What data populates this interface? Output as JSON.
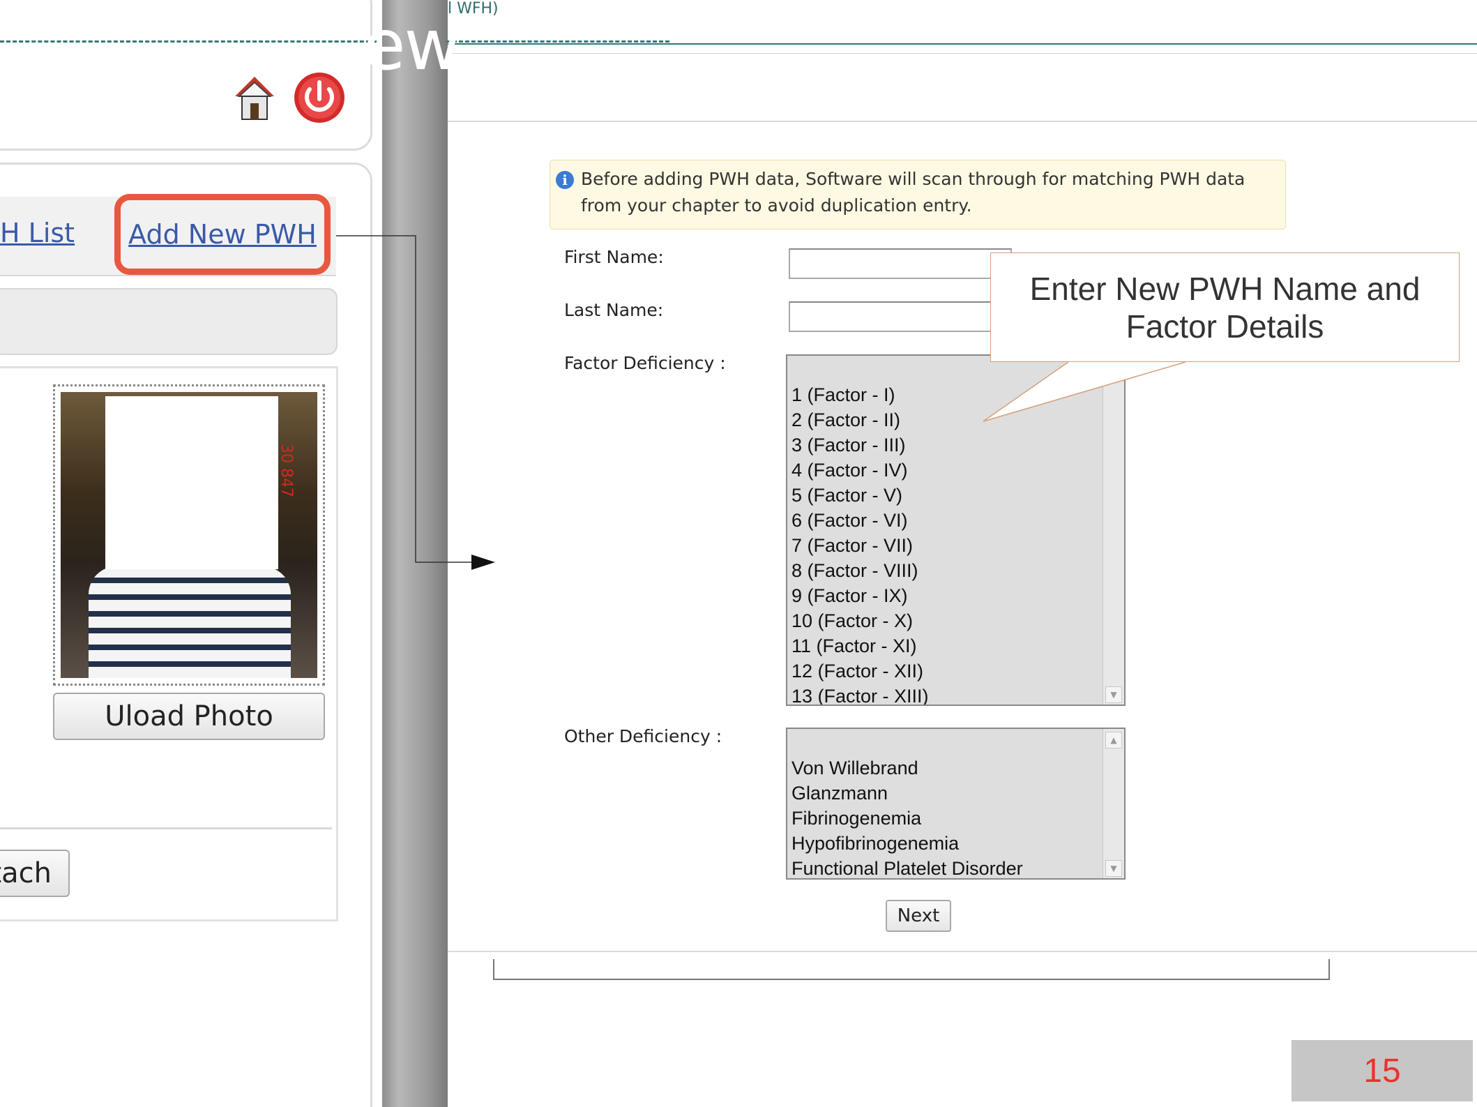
{
  "slide": {
    "title_fragment": "ew",
    "page_number": "15"
  },
  "left_panel": {
    "tabs": [
      {
        "label": "H List"
      },
      {
        "label": "Add New PWH"
      }
    ],
    "upload_photo_label": "Uload Photo",
    "attach_label": "tach",
    "photo_stamp": "30 847",
    "icons": [
      "home-icon",
      "power-icon"
    ]
  },
  "right_panel": {
    "top_label": "l WFH)",
    "info_message": "Before adding PWH data, Software will scan through for matching PWH data from your chapter to avoid duplication entry.",
    "form": {
      "first_name_label": "First Name:",
      "first_name_value": "",
      "last_name_label": "Last Name:",
      "last_name_value": "",
      "factor_deficiency_label": "Factor Deficiency :",
      "factor_options": [
        "1 (Factor - I)",
        "2 (Factor - II)",
        "3 (Factor - III)",
        "4 (Factor - IV)",
        "5 (Factor - V)",
        "6 (Factor - VI)",
        "7 (Factor - VII)",
        "8 (Factor - VIII)",
        "9 (Factor - IX)",
        "10 (Factor - X)",
        "11 (Factor - XI)",
        "12 (Factor - XII)",
        "13 (Factor - XIII)"
      ],
      "other_deficiency_label": "Other Deficiency :",
      "other_options": [
        "Von Willebrand",
        "Glanzmann",
        "Fibrinogenemia",
        "Hypofibrinogenemia",
        "Functional Platelet Disorder"
      ],
      "next_label": "Next"
    }
  },
  "callout": {
    "text": "Enter New PWH Name and Factor Details"
  },
  "colors": {
    "highlight_border": "#e8573f",
    "link": "#3a5aa8",
    "page_number": "#e8332a",
    "info_icon": "#3a7bd5"
  }
}
